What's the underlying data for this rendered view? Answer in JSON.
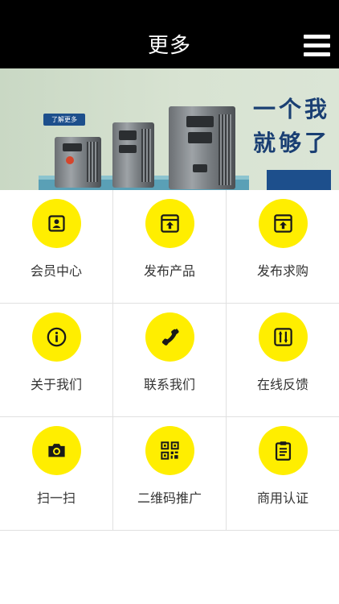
{
  "header": {
    "title": "更多",
    "menu_icon": "hamburger-menu-icon"
  },
  "banner": {
    "tag_text": "了解更多",
    "slogan_line1": "一个我",
    "slogan_line2": "就够了"
  },
  "colors": {
    "header_bg": "#000000",
    "accent_yellow": "#ffee00",
    "icon_dark": "#1a1a1a",
    "label_text": "#333333"
  },
  "grid": {
    "items": [
      {
        "label": "会员中心",
        "icon": "member-card-icon"
      },
      {
        "label": "发布产品",
        "icon": "publish-upload-icon"
      },
      {
        "label": "发布求购",
        "icon": "publish-upload-icon"
      },
      {
        "label": "关于我们",
        "icon": "info-icon"
      },
      {
        "label": "联系我们",
        "icon": "phone-icon"
      },
      {
        "label": "在线反馈",
        "icon": "feedback-sliders-icon"
      },
      {
        "label": "扫一扫",
        "icon": "camera-icon"
      },
      {
        "label": "二维码推广",
        "icon": "qr-code-icon"
      },
      {
        "label": "商用认证",
        "icon": "clipboard-icon"
      }
    ]
  }
}
